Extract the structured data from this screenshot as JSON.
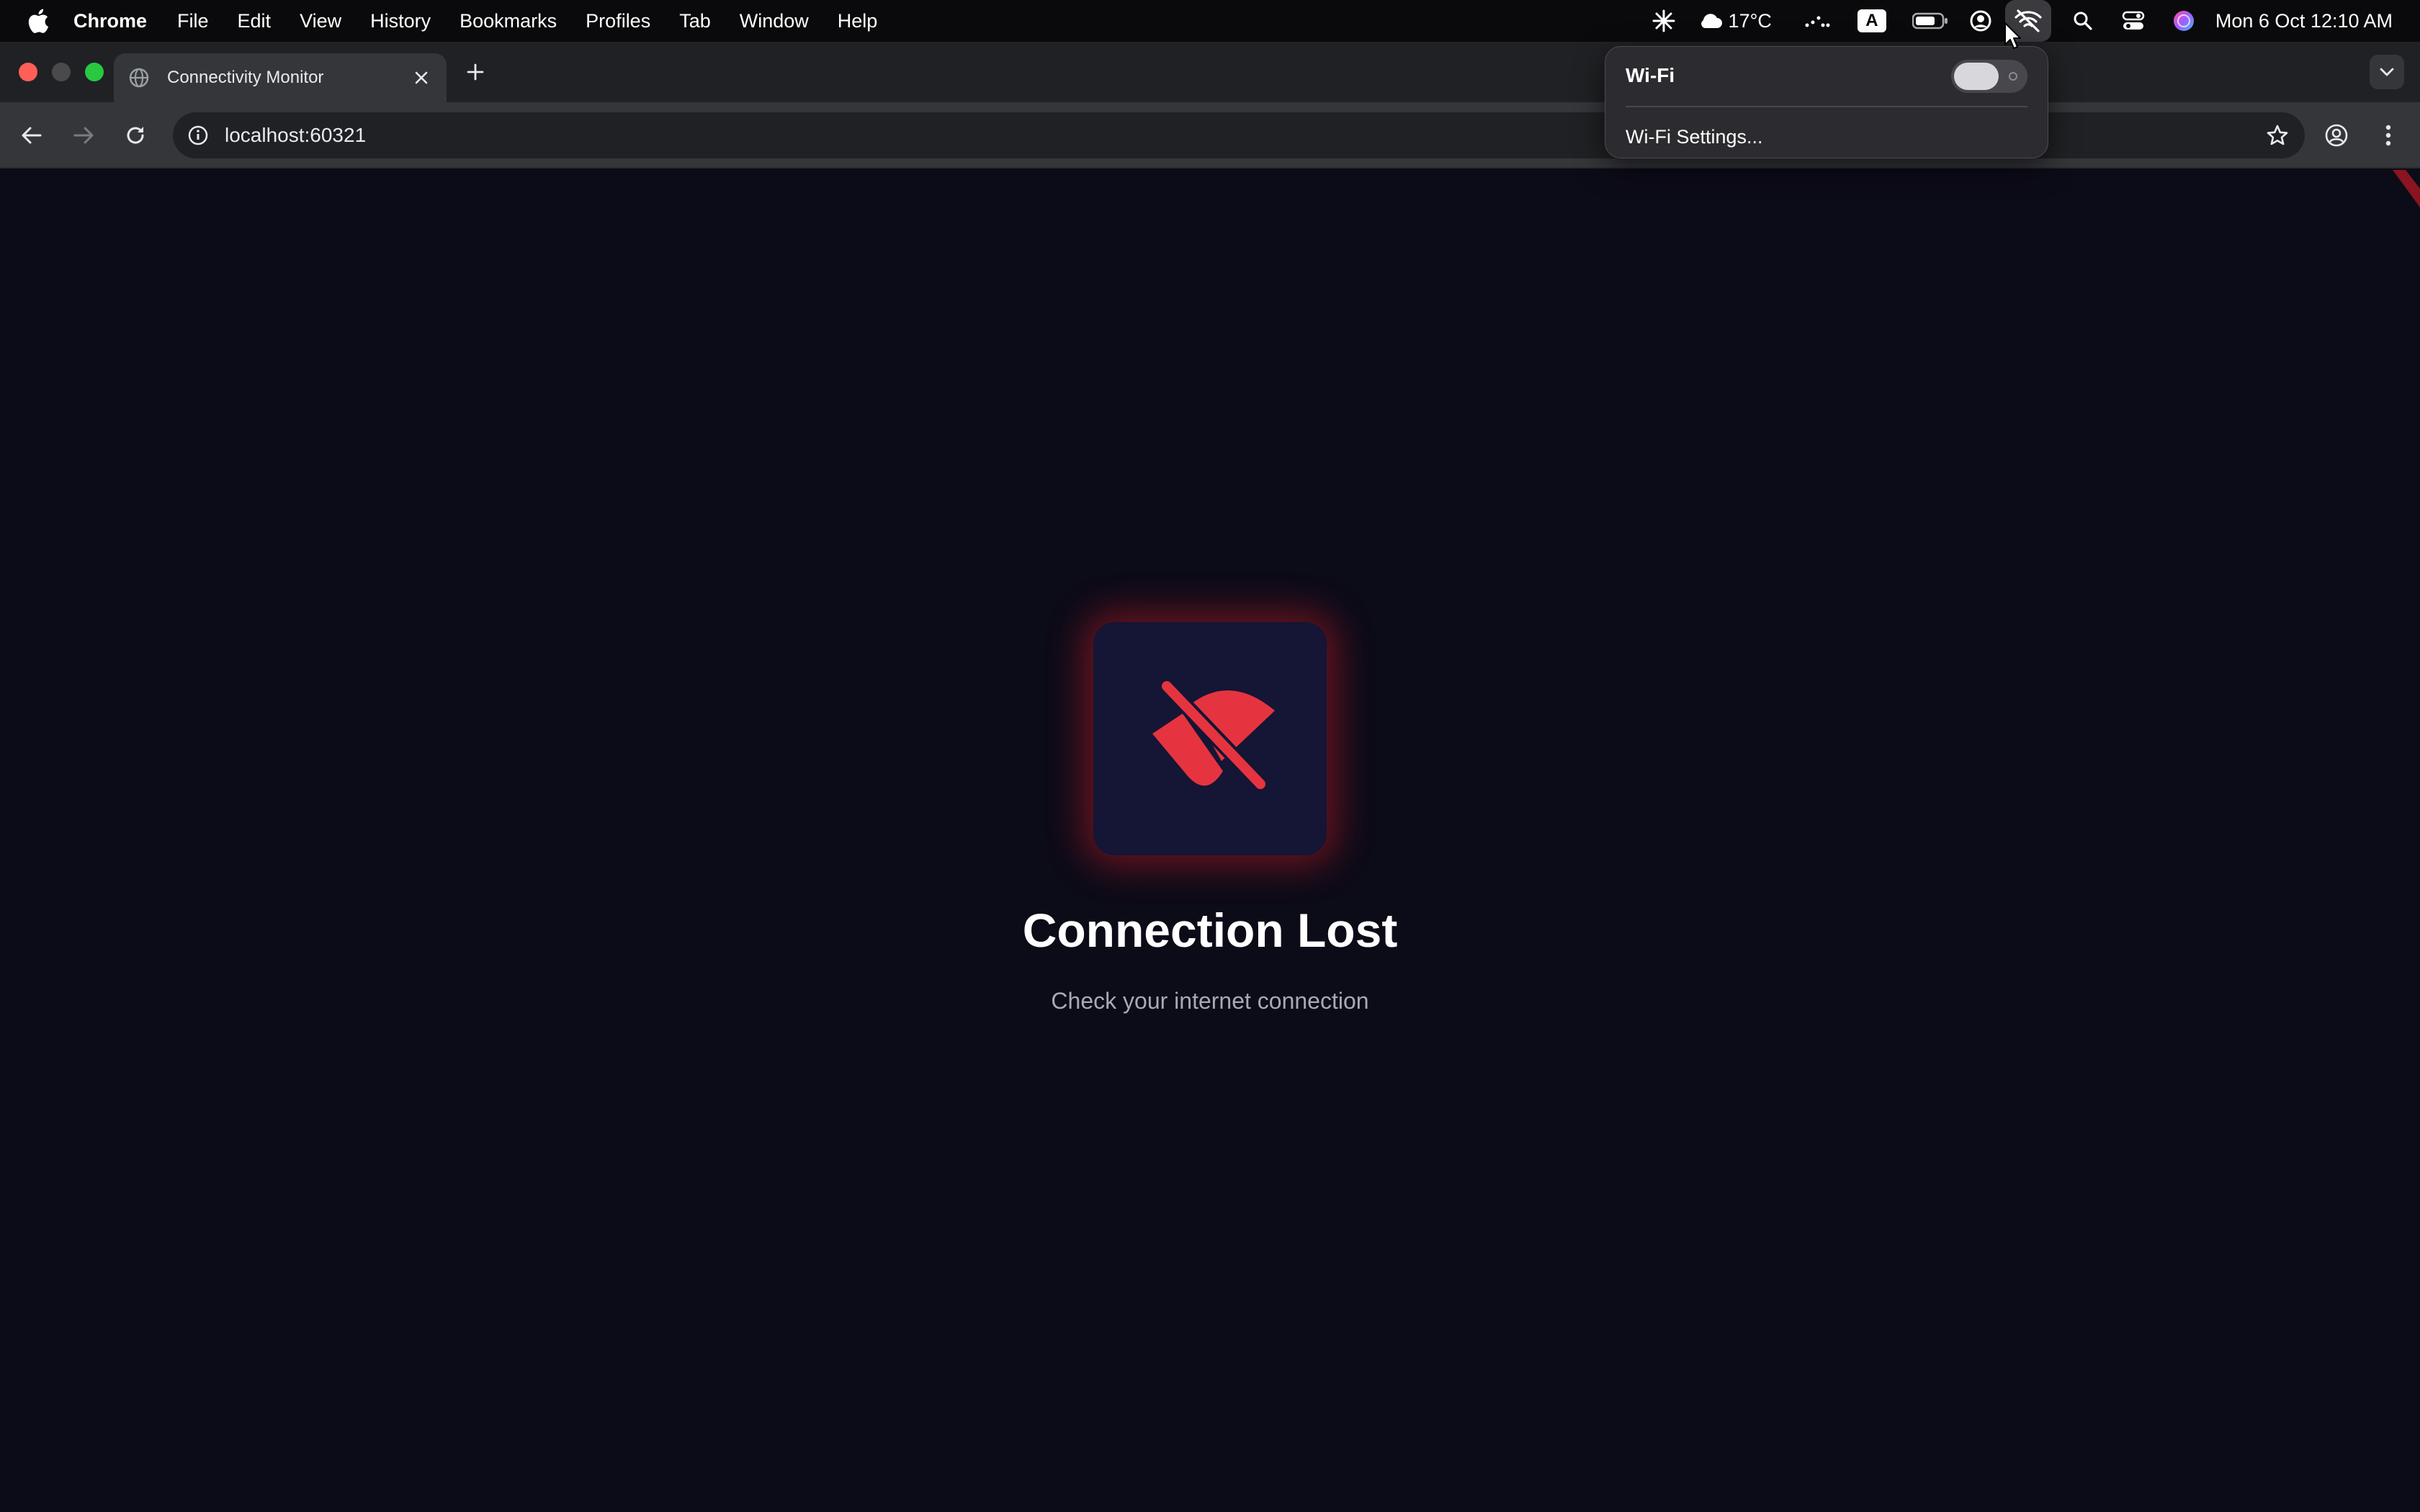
{
  "menubar": {
    "app_name": "Chrome",
    "items": [
      "File",
      "Edit",
      "View",
      "History",
      "Bookmarks",
      "Profiles",
      "Tab",
      "Window",
      "Help"
    ],
    "weather": "17°C",
    "keyboard_input": "A",
    "clock": "Mon 6 Oct  12:10 AM"
  },
  "browser": {
    "tab_title": "Connectivity Monitor",
    "url": "localhost:60321"
  },
  "page": {
    "headline": "Connection Lost",
    "subline": "Check your internet connection",
    "icon": "wifi-off-icon",
    "accent_color": "#e5343f",
    "background_color": "#0c0b18"
  },
  "wifi_menu": {
    "title": "Wi-Fi",
    "toggle_on": false,
    "settings_label": "Wi-Fi Settings..."
  }
}
